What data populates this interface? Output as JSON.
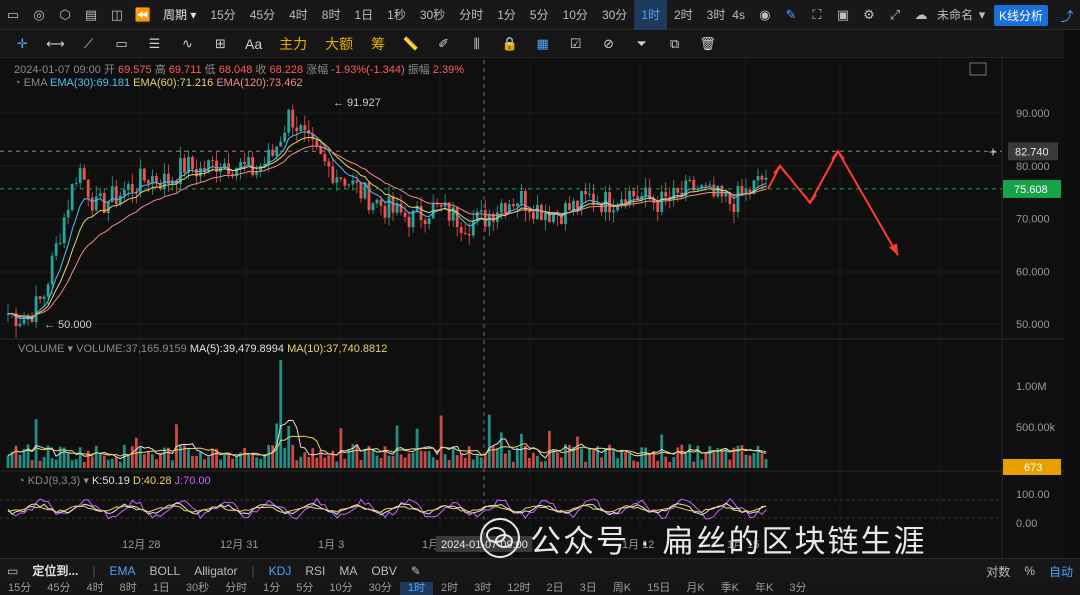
{
  "top_toolbar": {
    "timeframes": [
      {
        "label": "周期",
        "active": false,
        "period": true
      },
      {
        "label": "15分",
        "active": false
      },
      {
        "label": "45分",
        "active": false
      },
      {
        "label": "4时",
        "active": false
      },
      {
        "label": "8时",
        "active": false
      },
      {
        "label": "1日",
        "active": false
      },
      {
        "label": "1秒",
        "active": false
      },
      {
        "label": "30秒",
        "active": false
      },
      {
        "label": "分时",
        "active": false
      },
      {
        "label": "1分",
        "active": false
      },
      {
        "label": "5分",
        "active": false
      },
      {
        "label": "10分",
        "active": false
      },
      {
        "label": "30分",
        "active": false
      },
      {
        "label": "1时",
        "active": true
      },
      {
        "label": "2时",
        "active": false
      },
      {
        "label": "3时",
        "active": false
      }
    ],
    "countdown": "4s",
    "layout_name": "未命名",
    "kline_button": "K线分析"
  },
  "drawing_toolbar": {
    "main_force": "主力",
    "big_order": "大额",
    "chips": "筹",
    "text_tool": "Aa"
  },
  "ohlc": {
    "time": "2024-01-07 09:00",
    "open_label": "开",
    "open": "69.575",
    "high_label": "高",
    "high": "69.711",
    "low_label": "低",
    "low": "68.048",
    "close_label": "收",
    "close": "68.228",
    "change_label": "涨幅",
    "change": "-1.93%(-1.344)",
    "amplitude_label": "振幅",
    "amplitude": "2.39%"
  },
  "ema_legend": {
    "name": "EMA",
    "ema30": "EMA(30):69.181",
    "ema60": "EMA(60):71.216",
    "ema120": "EMA(120):73.462"
  },
  "volume_legend": {
    "name": "VOLUME",
    "value": "VOLUME:37,165.9159",
    "ma5": "MA(5):39,479.8994",
    "ma10": "MA(10):37,740.8812"
  },
  "kdj_legend": {
    "name": "KDJ(9,3,3)",
    "k": "K:50.19",
    "d": "D:40.28",
    "j": "J:70.00"
  },
  "price_axis": [
    "90.000",
    "80.000",
    "70.000",
    "60.000",
    "50.000"
  ],
  "price_markers": {
    "crosshair": "82.740",
    "last": "75.608",
    "high": "91.927",
    "low": "50.000"
  },
  "volume_axis": [
    "1.00M",
    "500.00k"
  ],
  "volume_last": "673",
  "kdj_axis": [
    "100.00",
    "0.00"
  ],
  "time_axis": [
    "12月 28",
    "12月 31",
    "1月 3",
    "1月 9",
    "1月 12",
    "1月 15"
  ],
  "crosshair_time": "2024-01-07 09:00",
  "colors": {
    "up": "#26a69a",
    "down": "#ef5350",
    "ema30": "#4fc3f7",
    "ema60": "#e6d36a",
    "ema120": "#f08a8a",
    "arrow": "#ff3b30",
    "last_price": "#16a34a"
  },
  "bottom_bar": {
    "locate": "定位到...",
    "indicators": [
      {
        "label": "EMA",
        "active": true
      },
      {
        "label": "BOLL",
        "active": false
      },
      {
        "label": "Alligator",
        "active": false
      }
    ],
    "sub_indicators": [
      {
        "label": "KDJ",
        "active": true
      },
      {
        "label": "RSI",
        "active": false
      },
      {
        "label": "MA",
        "active": false
      },
      {
        "label": "OBV",
        "active": false
      }
    ],
    "log": "对数",
    "percent": "%",
    "auto": "自动"
  },
  "bottom_timeframes": [
    "15分",
    "45分",
    "4时",
    "8时",
    "1日",
    "30秒",
    "分时",
    "1分",
    "5分",
    "10分",
    "30分",
    "1时",
    "2时",
    "3时",
    "12时",
    "2日",
    "3日",
    "周K",
    "15日",
    "月K",
    "季K",
    "年K",
    "3分"
  ],
  "watermark": {
    "text": "公众号 · 扁丝的区块链生涯"
  },
  "chart_data": {
    "type": "candlestick",
    "interval": "1时",
    "ylim": [
      45,
      95
    ],
    "x_tick_labels": [
      "12月 28",
      "12月 31",
      "1月 3",
      "1月 9",
      "1月 12",
      "1月 15"
    ],
    "anchor_prices": [
      52,
      51,
      55,
      68,
      80,
      72,
      74,
      76,
      78,
      77,
      80,
      79,
      81,
      80,
      79,
      82,
      90,
      84,
      80,
      78,
      75,
      73,
      71,
      70,
      72,
      71,
      69,
      70,
      73,
      74,
      72,
      71,
      72,
      74,
      73,
      75,
      74,
      73,
      74,
      76,
      74,
      73,
      75,
      78
    ],
    "annotations": {
      "max": 91.927,
      "min": 50.0,
      "last": 75.608,
      "crosshair": 82.74
    },
    "forecast_path": [
      75.608,
      80.0,
      73.0,
      82.74,
      63.0
    ]
  }
}
